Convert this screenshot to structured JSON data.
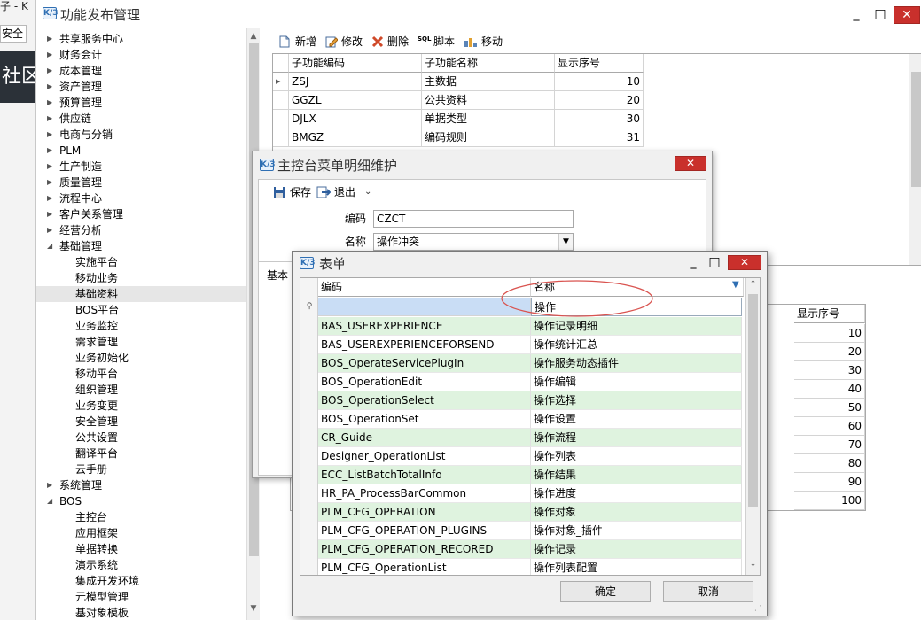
{
  "background_app": {
    "title_fragment": "子 - K",
    "tab_label": "安全",
    "dark_banner_text": "社区"
  },
  "main_window": {
    "title": "功能发布管理",
    "logo_text": "K/3",
    "controls": {
      "minimize": "_",
      "maximize": "□",
      "close": "✕"
    }
  },
  "tree": {
    "items": [
      {
        "label": "共享服务中心",
        "level": 0,
        "expanded": false
      },
      {
        "label": "财务会计",
        "level": 0,
        "expanded": false
      },
      {
        "label": "成本管理",
        "level": 0,
        "expanded": false
      },
      {
        "label": "资产管理",
        "level": 0,
        "expanded": false
      },
      {
        "label": "预算管理",
        "level": 0,
        "expanded": false
      },
      {
        "label": "供应链",
        "level": 0,
        "expanded": false
      },
      {
        "label": "电商与分销",
        "level": 0,
        "expanded": false
      },
      {
        "label": "PLM",
        "level": 0,
        "expanded": false
      },
      {
        "label": "生产制造",
        "level": 0,
        "expanded": false
      },
      {
        "label": "质量管理",
        "level": 0,
        "expanded": false
      },
      {
        "label": "流程中心",
        "level": 0,
        "expanded": false
      },
      {
        "label": "客户关系管理",
        "level": 0,
        "expanded": false
      },
      {
        "label": "经营分析",
        "level": 0,
        "expanded": false
      },
      {
        "label": "基础管理",
        "level": 0,
        "expanded": true
      },
      {
        "label": "实施平台",
        "level": 1
      },
      {
        "label": "移动业务",
        "level": 1
      },
      {
        "label": "基础资料",
        "level": 1,
        "selected": true
      },
      {
        "label": "BOS平台",
        "level": 1
      },
      {
        "label": "业务监控",
        "level": 1
      },
      {
        "label": "需求管理",
        "level": 1
      },
      {
        "label": "业务初始化",
        "level": 1
      },
      {
        "label": "移动平台",
        "level": 1
      },
      {
        "label": "组织管理",
        "level": 1
      },
      {
        "label": "业务变更",
        "level": 1
      },
      {
        "label": "安全管理",
        "level": 1
      },
      {
        "label": "公共设置",
        "level": 1
      },
      {
        "label": "翻译平台",
        "level": 1
      },
      {
        "label": "云手册",
        "level": 1
      },
      {
        "label": "系统管理",
        "level": 0,
        "expanded": false
      },
      {
        "label": "BOS",
        "level": 0,
        "expanded": true
      },
      {
        "label": "主控台",
        "level": 1
      },
      {
        "label": "应用框架",
        "level": 1
      },
      {
        "label": "单据转换",
        "level": 1
      },
      {
        "label": "演示系统",
        "level": 1
      },
      {
        "label": "集成开发环境",
        "level": 1
      },
      {
        "label": "元模型管理",
        "level": 1
      },
      {
        "label": "基对象模板",
        "level": 1
      }
    ]
  },
  "toolbar": {
    "new": "新增",
    "edit": "修改",
    "delete": "删除",
    "script": "脚本",
    "move": "移动",
    "sql_icon_text": "SQL"
  },
  "sub_grid": {
    "headers": [
      "子功能编码",
      "子功能名称",
      "显示序号"
    ],
    "rows": [
      {
        "code": "ZSJ",
        "name": "主数据",
        "seq": "10"
      },
      {
        "code": "GGZL",
        "name": "公共资料",
        "seq": "20"
      },
      {
        "code": "DJLX",
        "name": "单据类型",
        "seq": "30"
      },
      {
        "code": "BMGZ",
        "name": "编码规则",
        "seq": "31"
      }
    ]
  },
  "lower_grid": {
    "header": "显示序号",
    "values": [
      "10",
      "20",
      "30",
      "40",
      "50",
      "60",
      "70",
      "80",
      "90",
      "100"
    ]
  },
  "dialog_menu": {
    "title": "主控台菜单明细维护",
    "save": "保存",
    "exit": "退出",
    "code_label": "编码",
    "code_value": "CZCT",
    "name_label": "名称",
    "name_value": "操作冲突",
    "tab_label": "基本",
    "close": "✕"
  },
  "dialog_form": {
    "title": "表单",
    "col_code": "编码",
    "col_name": "名称",
    "filter_value": "操作",
    "confirm": "确定",
    "cancel": "取消",
    "rows": [
      {
        "code": "BAS_USEREXPERIENCE",
        "name": "操作记录明细"
      },
      {
        "code": "BAS_USEREXPERIENCEFORSEND",
        "name": "操作统计汇总"
      },
      {
        "code": "BOS_OperateServicePlugIn",
        "name": "操作服务动态插件"
      },
      {
        "code": "BOS_OperationEdit",
        "name": "操作编辑"
      },
      {
        "code": "BOS_OperationSelect",
        "name": "操作选择"
      },
      {
        "code": "BOS_OperationSet",
        "name": "操作设置"
      },
      {
        "code": "CR_Guide",
        "name": "操作流程"
      },
      {
        "code": "Designer_OperationList",
        "name": "操作列表"
      },
      {
        "code": "ECC_ListBatchTotalInfo",
        "name": "操作结果"
      },
      {
        "code": "HR_PA_ProcessBarCommon",
        "name": "操作进度"
      },
      {
        "code": "PLM_CFG_OPERATION",
        "name": "操作对象"
      },
      {
        "code": "PLM_CFG_OPERATION_PLUGINS",
        "name": "操作对象_插件"
      },
      {
        "code": "PLM_CFG_OPERATION_RECORED",
        "name": "操作记录"
      },
      {
        "code": "PLM_CFG_OperationList",
        "name": "操作列表配置"
      }
    ],
    "highlight_color": "#dff3df",
    "annotation_color": "#d9534f"
  }
}
